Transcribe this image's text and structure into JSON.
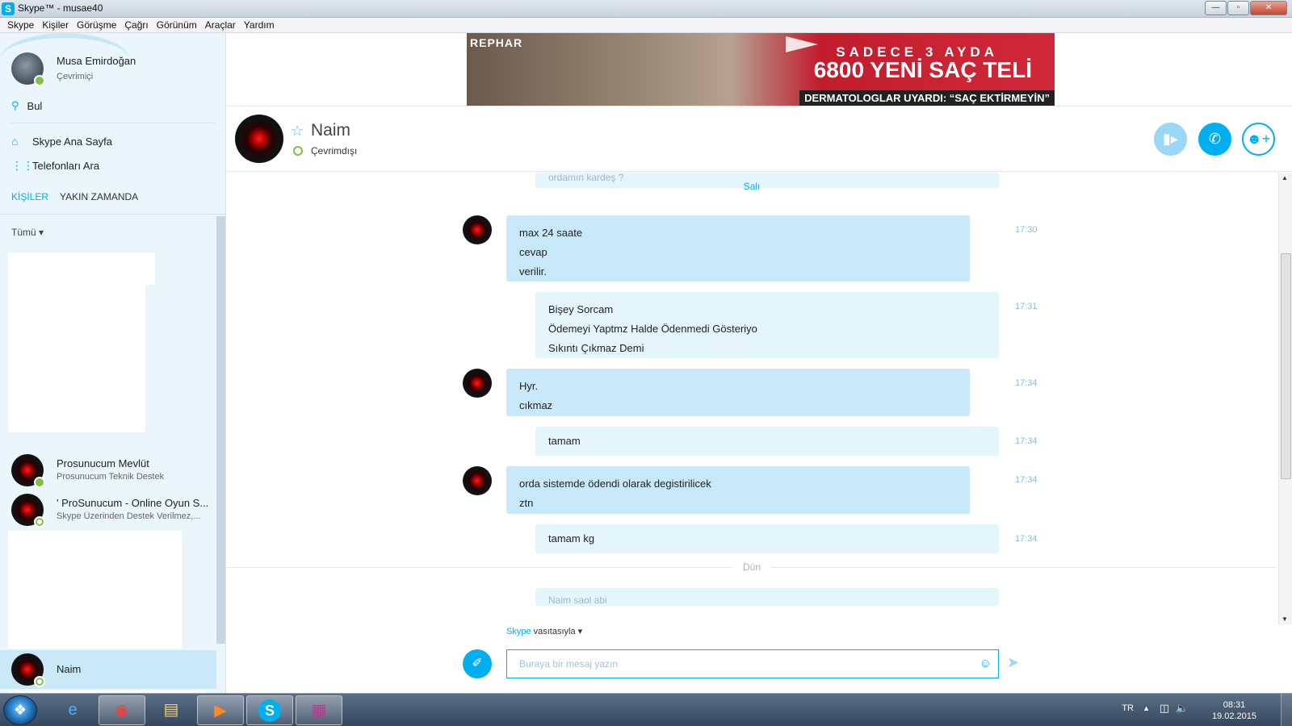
{
  "window": {
    "title": "Skype™ - musae40",
    "app_icon": "S",
    "btn_min": "—",
    "btn_max": "▫",
    "btn_close": "✕"
  },
  "menu": [
    "Skype",
    "Kişiler",
    "Görüşme",
    "Çağrı",
    "Görünüm",
    "Araçlar",
    "Yardım"
  ],
  "profile": {
    "name": "Musa Emirdoğan",
    "status": "Çevrimiçi"
  },
  "search": {
    "label": "Bul"
  },
  "nav": {
    "home": "Skype Ana Sayfa",
    "phones": "Telefonları Ara"
  },
  "tabs": {
    "contacts": "KİŞİLER",
    "recent": "YAKIN ZAMANDA"
  },
  "filter": {
    "label": "Tümü ▾"
  },
  "contacts": [
    {
      "name": "Prosunucum Mevlüt",
      "mood": "Prosunucum Teknik Destek"
    },
    {
      "name": "' ProSunucum - Online Oyun S...",
      "mood": "Skype Üzerinden Destek Verilmez,..."
    },
    {
      "name": "Naim",
      "mood": ""
    }
  ],
  "ad": {
    "brand": "REPHAR",
    "line1": "SADECE 3 AYDA",
    "line2": "6800 YENİ SAÇ TELİ",
    "line3": "DERMATOLOGLAR UYARDI: “SAÇ EKTİRMEYİN”"
  },
  "chat": {
    "name": "Naim",
    "status": "Çevrimdışı",
    "day_top": "Salı",
    "day_bottom": "Dün",
    "ghost_top": "ordamın kardeş ?",
    "ghost_bottom": "Naim  saol  abi",
    "messages": [
      {
        "dir": "in",
        "lines": [
          "max 24 saate",
          "cevap",
          "verilir."
        ],
        "time": "17:30"
      },
      {
        "dir": "out",
        "lines": [
          "Bişey Sorcam",
          "Ödemeyi Yaptmz Halde Ödenmedi Gösteriyo",
          "Sıkıntı Çıkmaz Demi"
        ],
        "time": "17:31"
      },
      {
        "dir": "in",
        "lines": [
          "Hyr.",
          "cıkmaz"
        ],
        "time": "17:34"
      },
      {
        "dir": "out",
        "lines": [
          "tamam"
        ],
        "time": "17:34"
      },
      {
        "dir": "in",
        "lines": [
          "orda sistemde ödendi olarak degistirilicek",
          "ztn"
        ],
        "time": "17:34"
      },
      {
        "dir": "out",
        "lines": [
          "tamam kg"
        ],
        "time": "17:34"
      }
    ]
  },
  "compose": {
    "via_brand": "Skype",
    "via_text": " vasıtasıyla ▾",
    "placeholder": "Buraya bir mesaj yazın"
  },
  "taskbar": {
    "lang": "TR",
    "time": "08:31",
    "date": "19.02.2015"
  },
  "icons": {
    "search": "search-icon",
    "home": "home-icon",
    "dialpad": "dialpad-icon",
    "star": "star-icon",
    "video": "video-call-icon",
    "call": "phone-icon",
    "add_contact": "add-contact-icon",
    "attach": "paperclip-icon",
    "emoji": "emoticon-icon",
    "send": "send-icon"
  },
  "colors": {
    "accent": "#00aff0",
    "incoming_bubble": "#c7e9fa",
    "outgoing_bubble": "#e5f5fc",
    "online": "#7dc142",
    "sidebar_bg": "#eaf5fc"
  }
}
